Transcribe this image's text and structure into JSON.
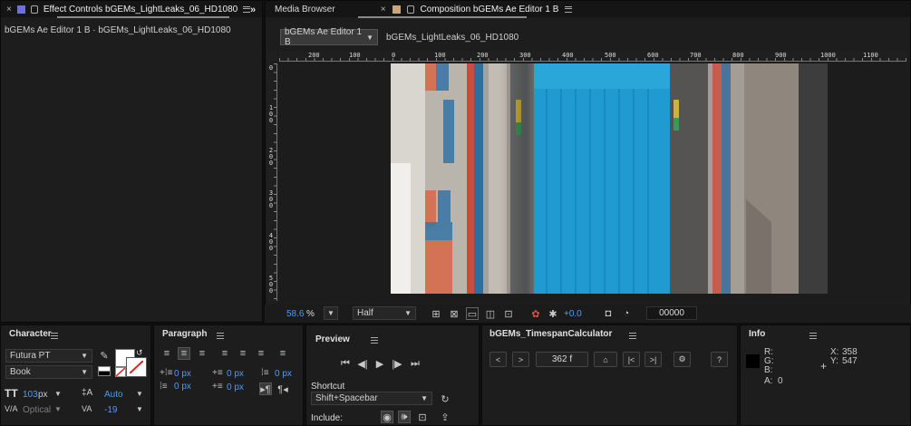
{
  "left_panel": {
    "tab_label": "Effect Controls bGEMs_LightLeaks_06_HD1080",
    "subtitle": "bGEMs Ae Editor 1 B · bGEMs_LightLeaks_06_HD1080",
    "chip_color": "#6f6fe0"
  },
  "comp_panel": {
    "tab_media": "Media Browser",
    "tab_comp": "Composition bGEMs Ae Editor 1 B",
    "chip_color": "#c8a878",
    "comp_select": "bGEMs Ae Editor 1 B",
    "layer_name": "bGEMs_LightLeaks_06_HD1080",
    "ruler_h": [
      "200",
      "100",
      "0",
      "100",
      "200",
      "300",
      "400",
      "500",
      "600",
      "700",
      "800",
      "900",
      "1000",
      "1100"
    ],
    "ruler_v": [
      [
        "0"
      ],
      [
        "1",
        "0",
        "0"
      ],
      [
        "2",
        "0",
        "0"
      ],
      [
        "3",
        "0",
        "0"
      ],
      [
        "4",
        "0",
        "0"
      ],
      [
        "5",
        "0",
        "0"
      ]
    ],
    "zoom": "58.6",
    "zoom_unit": "%",
    "resolution": "Half",
    "exposure": "+0.0",
    "timecode": "00000"
  },
  "character": {
    "title": "Character",
    "font_family": "Futura PT",
    "font_style": "Book",
    "font_size": "103",
    "font_size_unit": "px",
    "leading": "Auto",
    "kerning": "Optical",
    "tracking": "-19"
  },
  "paragraph": {
    "title": "Paragraph",
    "indent_left": "0 px",
    "indent_first": "0 px",
    "space_before": "0 px",
    "indent_right": "0 px",
    "space_after": "0 px"
  },
  "preview": {
    "title": "Preview",
    "shortcut_label": "Shortcut",
    "shortcut_value": "Shift+Spacebar",
    "include_label": "Include:"
  },
  "timespan": {
    "title": "bGEMs_TimespanCalculator",
    "frames": "362 f",
    "help": "?"
  },
  "info": {
    "title": "Info",
    "r_label": "R:",
    "g_label": "G:",
    "b_label": "B:",
    "a_label": "A:",
    "a_value": "0",
    "x_label": "X:",
    "x_value": "358",
    "y_label": "Y:",
    "y_value": "547"
  },
  "colors": {
    "accent_blue": "#4f9bf0",
    "panel_bg": "#1d1d1d",
    "pool_blue": "#1f9bd1"
  }
}
